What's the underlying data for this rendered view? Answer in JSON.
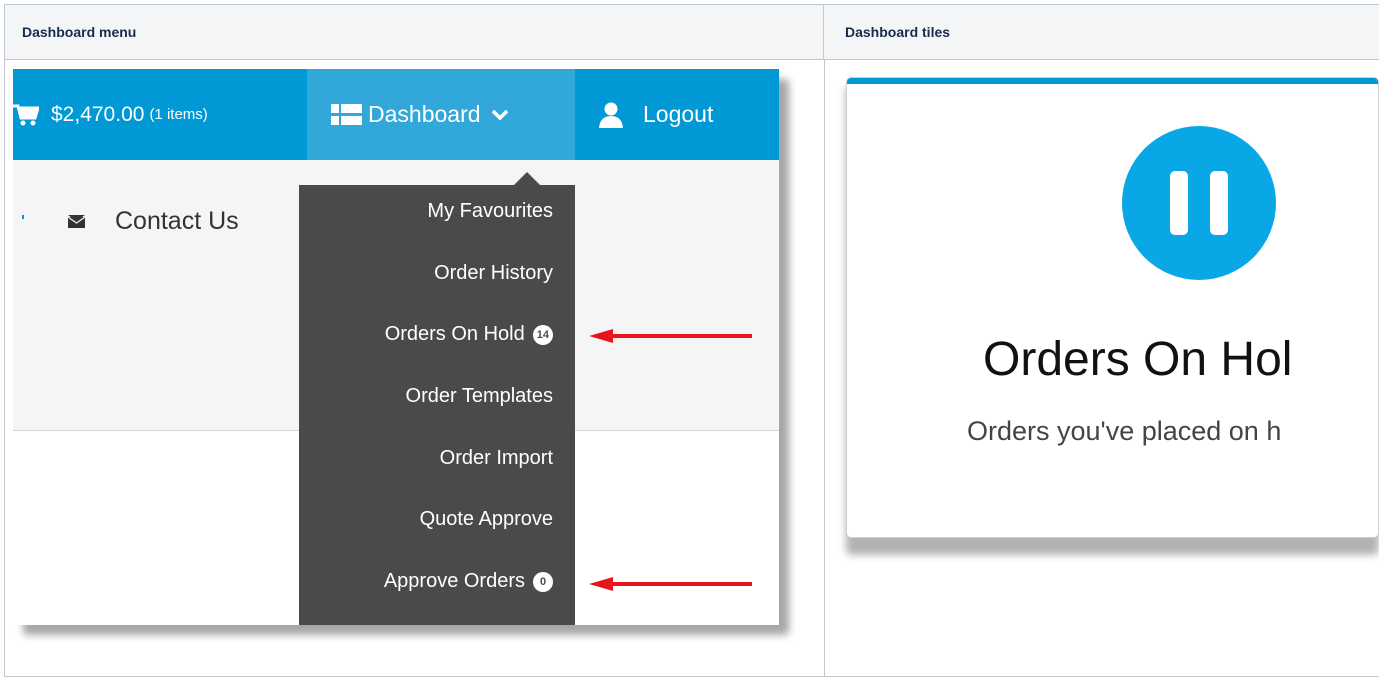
{
  "table": {
    "headers": [
      "Dashboard menu",
      "Dashboard tiles"
    ]
  },
  "menu_screenshot": {
    "cart": {
      "amount": "$2,470.00",
      "items": "(1 items)"
    },
    "dashboard_label": "Dashboard",
    "logout_label": "Logout",
    "contact_label": "Contact Us",
    "menu_items": [
      {
        "label": "My Favourites",
        "badge": null
      },
      {
        "label": "Order History",
        "badge": null
      },
      {
        "label": "Orders On Hold",
        "badge": "14"
      },
      {
        "label": "Order Templates",
        "badge": null
      },
      {
        "label": "Order Import",
        "badge": null
      },
      {
        "label": "Quote Approve",
        "badge": null
      },
      {
        "label": "Approve Orders",
        "badge": "0"
      }
    ],
    "colors": {
      "topbar": "#0099d6",
      "active_tab": "#32a8da",
      "menu_bg": "#4a4a4a",
      "arrow": "#e8141b"
    }
  },
  "tile_screenshot": {
    "icon": "pause-icon",
    "title": "Orders On Hol",
    "subtitle": "Orders you've placed on h",
    "colors": {
      "accent": "#0099d6",
      "icon_bg": "#0aa7e6"
    }
  }
}
